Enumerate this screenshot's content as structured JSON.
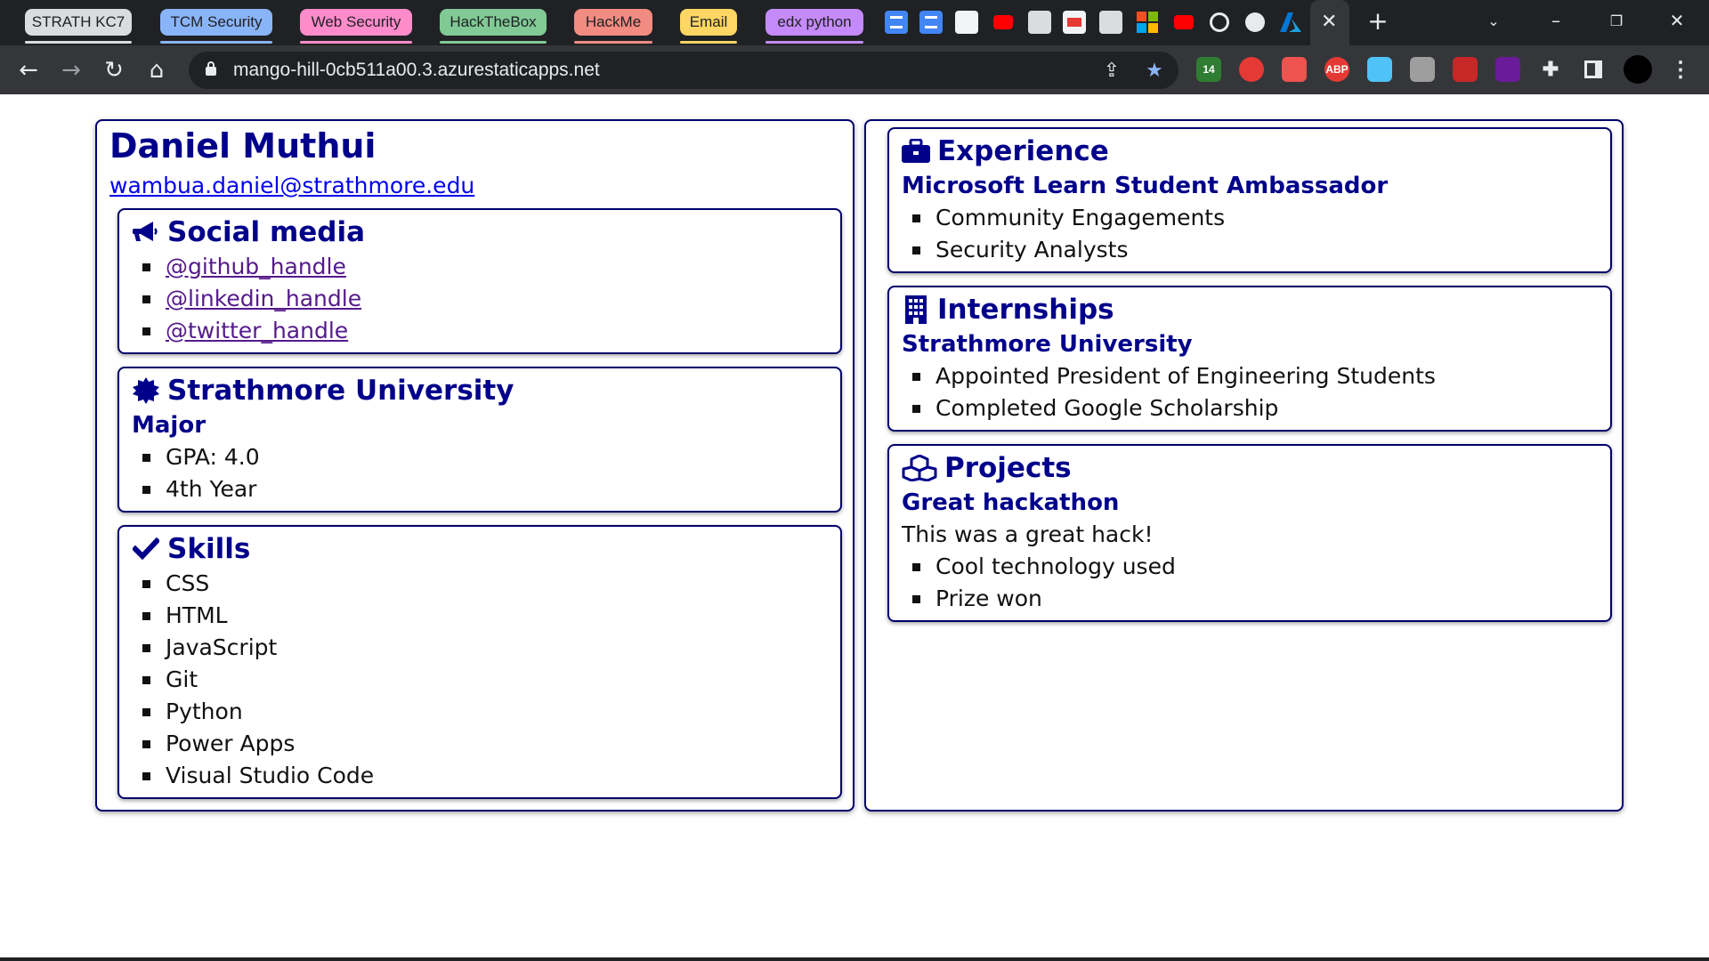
{
  "browser": {
    "tab_groups": [
      {
        "label": "STRATH KC7",
        "color": "#dadce0"
      },
      {
        "label": "TCM Security",
        "color": "#8ab4f8"
      },
      {
        "label": "Web Security",
        "color": "#ff8bcb"
      },
      {
        "label": "HackTheBox",
        "color": "#81c995"
      },
      {
        "label": "HackMe",
        "color": "#f28b82"
      },
      {
        "label": "Email",
        "color": "#fdd663"
      },
      {
        "label": "edx python",
        "color": "#c58af9"
      }
    ],
    "address_bar": {
      "url": "mango-hill-0cb511a00.3.azurestaticapps.net"
    },
    "extension_badge": "14",
    "adblock_label": "ABP"
  },
  "profile": {
    "name": "Daniel Muthui",
    "email": "wambua.daniel@strathmore.edu"
  },
  "social": {
    "title": "Social media",
    "icon": "megaphone-icon",
    "links": [
      "@github_handle",
      "@linkedin_handle",
      "@twitter_handle"
    ]
  },
  "education": {
    "title": "Strathmore University",
    "icon": "certificate-icon",
    "subtitle": "Major",
    "items": [
      "GPA: 4.0",
      "4th Year"
    ]
  },
  "skills": {
    "title": "Skills",
    "icon": "check-icon",
    "items": [
      "CSS",
      "HTML",
      "JavaScript",
      "Git",
      "Python",
      "Power Apps",
      "Visual Studio Code"
    ]
  },
  "experience": {
    "title": "Experience",
    "icon": "briefcase-icon",
    "subtitle": "Microsoft Learn Student Ambassador",
    "items": [
      "Community Engagements",
      "Security Analysts"
    ]
  },
  "internships": {
    "title": "Internships",
    "icon": "building-icon",
    "subtitle": "Strathmore University",
    "items": [
      "Appointed President of Engineering Students",
      "Completed Google Scholarship"
    ]
  },
  "projects": {
    "title": "Projects",
    "icon": "cubes-icon",
    "subtitle": "Great hackathon",
    "description": "This was a great hack!",
    "items": [
      "Cool technology used",
      "Prize won"
    ]
  },
  "colors": {
    "heading": "#00008b",
    "border": "#00006b",
    "link": "#0000ee",
    "visited_link": "#551a8b"
  }
}
